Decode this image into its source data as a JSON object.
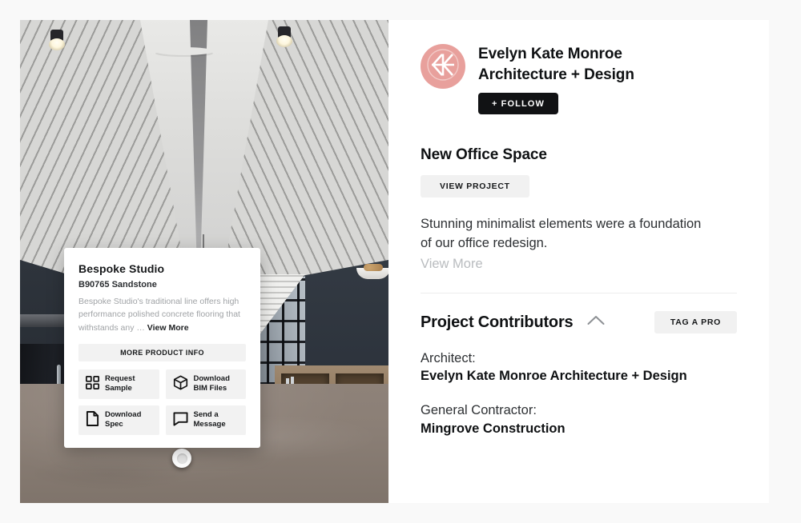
{
  "creator": {
    "avatar_icon": "logo-chevron-mark",
    "avatar_color": "#e8a09c",
    "name_line1": "Evelyn Kate Monroe",
    "name_line2": "Architecture + Design",
    "follow_label": "+ FOLLOW"
  },
  "project": {
    "title": "New Office Space",
    "view_project_label": "VIEW PROJECT",
    "description": "Stunning minimalist elements were a foundation of our office redesign.",
    "view_more_label": "View More"
  },
  "contributors": {
    "heading": "Project Contributors",
    "collapse_icon": "chevron-up-icon",
    "tag_pro_label": "TAG A PRO",
    "entries": [
      {
        "role": "Architect:",
        "name": "Evelyn Kate Monroe Architecture + Design"
      },
      {
        "role": "General Contractor:",
        "name": "Mingrove Construction"
      }
    ]
  },
  "product_card": {
    "title": "Bespoke Studio",
    "sku": "B90765 Sandstone",
    "description": "Bespoke Studio's traditional line offers high performance polished concrete flooring that withstands any … ",
    "view_more_label": "View More",
    "more_info_label": "MORE PRODUCT INFO",
    "actions": [
      {
        "icon": "grid-squares-icon",
        "line1": "Request",
        "line2": "Sample"
      },
      {
        "icon": "cube-3d-icon",
        "line1": "Download",
        "line2": "BIM Files"
      },
      {
        "icon": "document-page-icon",
        "line1": "Download",
        "line2": "Spec"
      },
      {
        "icon": "speech-bubble-icon",
        "line1": "Send a",
        "line2": "Message"
      }
    ]
  },
  "photo": {
    "alt": "office-corridor-interior-photo",
    "hotspot_icon": "hotspot-marker"
  }
}
